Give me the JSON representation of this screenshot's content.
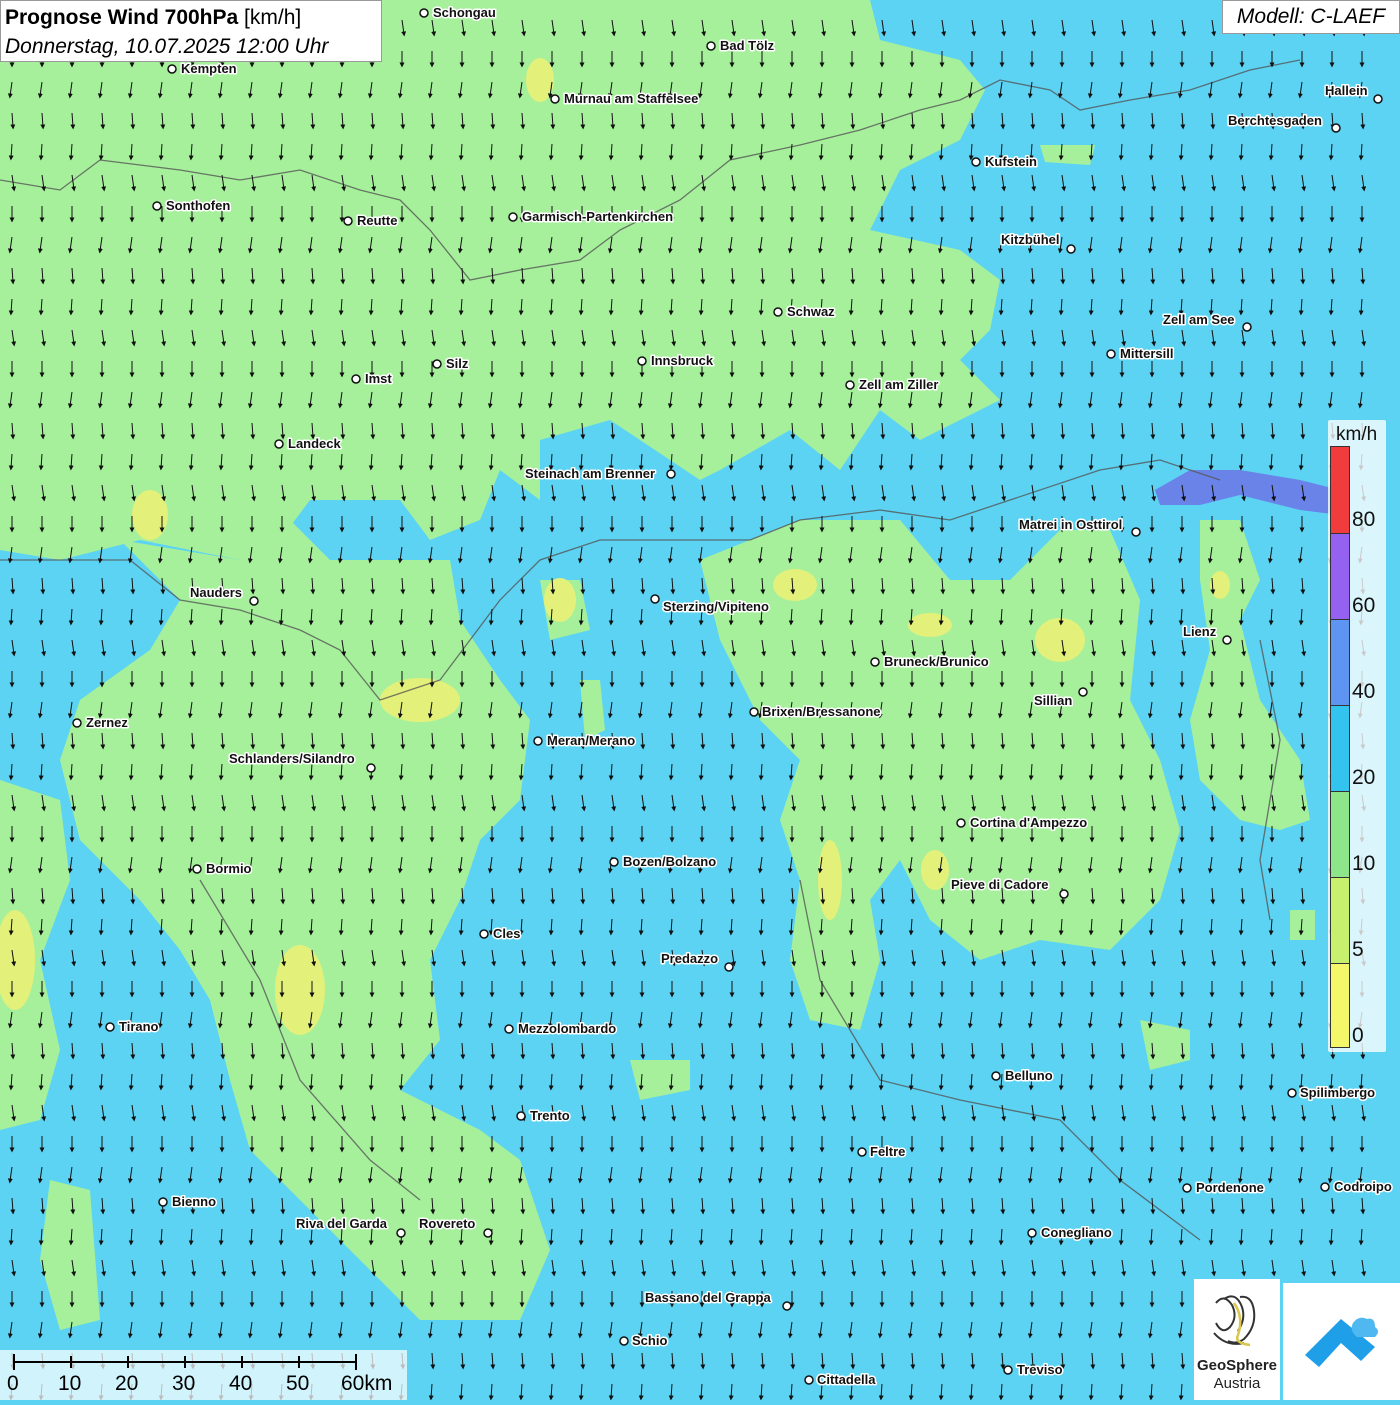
{
  "title": {
    "main": "Prognose Wind 700hPa",
    "unit": "[km/h]",
    "date": "Donnerstag, 10.07.2025 12:00 Uhr"
  },
  "model": "Modell: C-LAEF",
  "colors": {
    "ocean_blue": "#5cd3f2",
    "low_wind_green": "#a6f09c",
    "very_low_wind_yellow": "#e3f07a",
    "strong_wind_purple": "#6b7ae8"
  },
  "legend": {
    "unit": "km/h",
    "ticks": [
      "0",
      "5",
      "10",
      "20",
      "40",
      "60",
      "80"
    ],
    "bands": [
      {
        "from": 0,
        "color": "#f5f76a"
      },
      {
        "from": 5,
        "color": "#c7f06e"
      },
      {
        "from": 10,
        "color": "#8ee68b"
      },
      {
        "from": 20,
        "color": "#33c3ef"
      },
      {
        "from": 40,
        "color": "#5f95f2"
      },
      {
        "from": 60,
        "color": "#9561f0"
      },
      {
        "from": 80,
        "color": "#f03c3c"
      }
    ]
  },
  "scalebar": {
    "labels": [
      "0",
      "10",
      "20",
      "30",
      "40",
      "50",
      "60km"
    ]
  },
  "cities": [
    {
      "name": "Schongau"
    },
    {
      "name": "Bad Tölz"
    },
    {
      "name": "Kempten"
    },
    {
      "name": "Murnau am Staffelsee"
    },
    {
      "name": "Hallein"
    },
    {
      "name": "Berchtesgaden"
    },
    {
      "name": "Kufstein"
    },
    {
      "name": "Sonthofen"
    },
    {
      "name": "Reutte"
    },
    {
      "name": "Garmisch-Partenkirchen"
    },
    {
      "name": "Kitzbühel"
    },
    {
      "name": "Schwaz"
    },
    {
      "name": "Zell am See"
    },
    {
      "name": "Mittersill"
    },
    {
      "name": "Innsbruck"
    },
    {
      "name": "Silz"
    },
    {
      "name": "Imst"
    },
    {
      "name": "Zell am Ziller"
    },
    {
      "name": "Landeck"
    },
    {
      "name": "Steinach am Brenner"
    },
    {
      "name": "Matrei in Osttirol"
    },
    {
      "name": "Nauders"
    },
    {
      "name": "Sterzing/Vipiteno"
    },
    {
      "name": "Lienz"
    },
    {
      "name": "Bruneck/Brunico"
    },
    {
      "name": "Sillian"
    },
    {
      "name": "Zernez"
    },
    {
      "name": "Brixen/Bressanone"
    },
    {
      "name": "Meran/Merano"
    },
    {
      "name": "Schlanders/Silandro"
    },
    {
      "name": "Cortina d'Ampezzo"
    },
    {
      "name": "Bozen/Bolzano"
    },
    {
      "name": "Bormio"
    },
    {
      "name": "Pieve di Cadore"
    },
    {
      "name": "Cles"
    },
    {
      "name": "Predazzo"
    },
    {
      "name": "Tirano"
    },
    {
      "name": "Mezzolombardo"
    },
    {
      "name": "Belluno"
    },
    {
      "name": "Spilimbergo"
    },
    {
      "name": "Trento"
    },
    {
      "name": "Feltre"
    },
    {
      "name": "Bienno"
    },
    {
      "name": "Pordenone"
    },
    {
      "name": "Codroipo"
    },
    {
      "name": "Riva del Garda"
    },
    {
      "name": "Rovereto"
    },
    {
      "name": "Conegliano"
    },
    {
      "name": "Bassano del Grappa"
    },
    {
      "name": "Schio"
    },
    {
      "name": "Treviso"
    },
    {
      "name": "Cittadella"
    }
  ],
  "logo": {
    "brand_line1": "GeoSphere",
    "brand_line2": "Austria"
  }
}
